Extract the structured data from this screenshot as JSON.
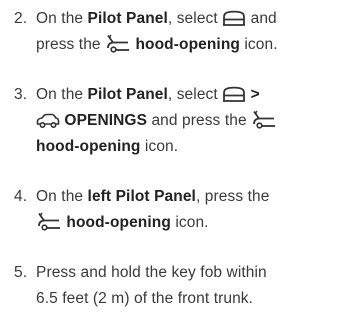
{
  "steps": [
    {
      "number": "2.",
      "t1": "On the ",
      "t2": "Pilot Panel",
      "t3": ", select ",
      "icon1": "vehicle-icon",
      "t4": " and",
      "t5": "press the ",
      "icon2": "hood-open-icon",
      "t6": " hood-opening",
      "t7": " icon."
    },
    {
      "number": "3.",
      "t1": "On the ",
      "t2": "Pilot Panel",
      "t3": ", select ",
      "icon1": "vehicle-icon",
      "t4": " >",
      "icon2": "car-openings-icon",
      "t5": " OPENINGS",
      "t6": " and press the ",
      "icon3": "hood-open-icon",
      "t7": "hood-opening",
      "t8": " icon."
    },
    {
      "number": "4.",
      "t1": "On the ",
      "t2": "left Pilot Panel",
      "t3": ", press the",
      "icon1": "hood-open-icon",
      "t4": " hood-opening",
      "t5": " icon."
    },
    {
      "number": "5.",
      "line1": "Press and hold the key fob within",
      "line2": "6.5 feet (2 m) of the front trunk."
    }
  ]
}
